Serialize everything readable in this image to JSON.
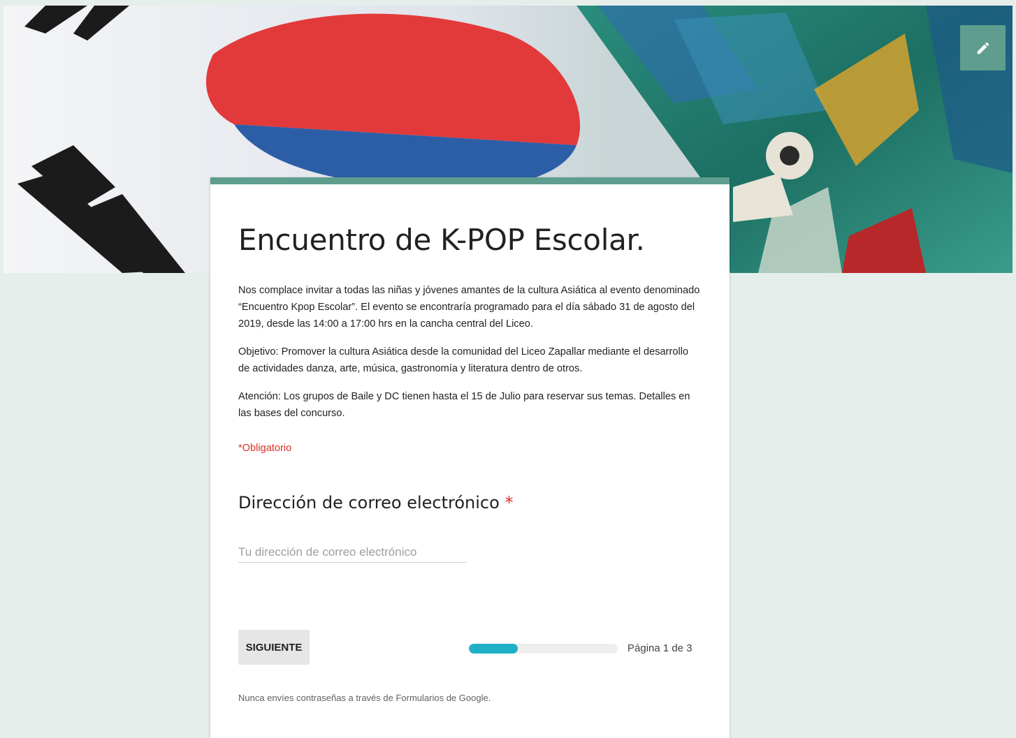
{
  "form": {
    "title": "Encuentro de K-POP Escolar.",
    "description": [
      "Nos complace invitar a todas las niñas y jóvenes amantes de la cultura Asiática al evento denominado “Encuentro Kpop Escolar”. El evento se encontraría programado para el día sábado 31 de agosto del 2019, desde las 14:00 a 17:00 hrs en la cancha central del Liceo.",
      "Objetivo: Promover la cultura Asiática desde la comunidad del Liceo Zapallar mediante el desarrollo de actividades danza, arte, música, gastronomía y literatura dentro de otros.",
      "Atención: Los grupos de Baile y DC tienen hasta el 15 de Julio para reservar sus temas. Detalles en las bases del concurso."
    ],
    "required_note": "*Obligatorio",
    "question": {
      "label": "Dirección de correo electrónico",
      "required_mark": "*",
      "placeholder": "Tu dirección de correo electrónico",
      "value": ""
    },
    "next_button": "SIGUIENTE",
    "progress": {
      "fraction": 0.33,
      "label": "Página 1 de 3"
    },
    "disclaimer": "Nunca envíes contraseñas a través de Formularios de Google."
  },
  "header": {
    "edit_icon": "pencil-icon"
  },
  "colors": {
    "theme": "#5f9e8e",
    "background": "#e6eeec",
    "progress_fill": "#1fb0c8",
    "required": "#d93025"
  }
}
